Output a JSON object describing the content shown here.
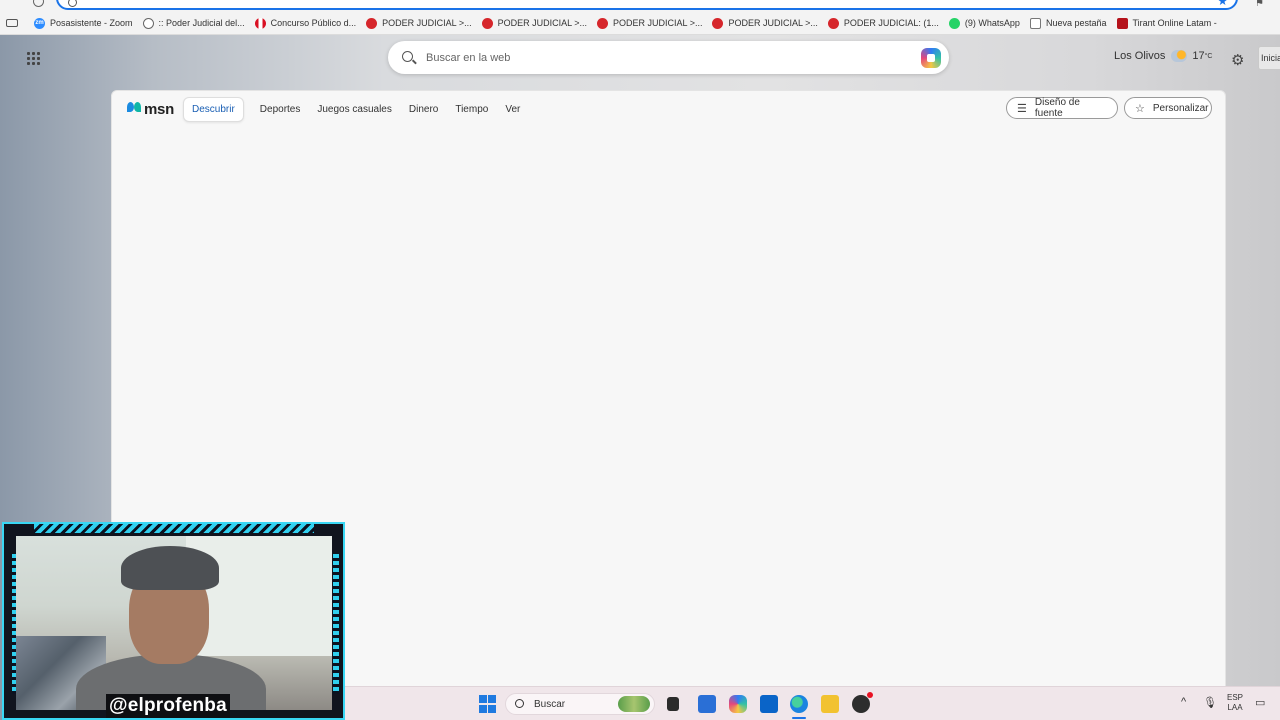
{
  "bookmarks": [
    {
      "label": "Posasistente - Zoom",
      "icon": "zoom-icon",
      "color": "#2d8cff"
    },
    {
      "label": ":: Poder Judicial del...",
      "icon": "globe-icon",
      "color": "#666666"
    },
    {
      "label": "Concurso Público d...",
      "icon": "peru-flag-icon",
      "color": "#d91023"
    },
    {
      "label": "PODER JUDICIAL >...",
      "icon": "pj-icon",
      "color": "#d6262b"
    },
    {
      "label": "PODER JUDICIAL >...",
      "icon": "pj-icon",
      "color": "#d6262b"
    },
    {
      "label": "PODER JUDICIAL >...",
      "icon": "pj-icon",
      "color": "#d6262b"
    },
    {
      "label": "PODER JUDICIAL >...",
      "icon": "pj-icon",
      "color": "#d6262b"
    },
    {
      "label": "PODER JUDICIAL: (1...",
      "icon": "pj-icon",
      "color": "#d6262b"
    },
    {
      "label": "(9) WhatsApp",
      "icon": "whatsapp-icon",
      "color": "#25d366"
    },
    {
      "label": "Nueva pestaña",
      "icon": "new-tab-icon",
      "color": "#777777"
    },
    {
      "label": "Tirant Online Latam -",
      "icon": "tirant-icon",
      "color": "#b5121b"
    }
  ],
  "search": {
    "placeholder": "Buscar en la web"
  },
  "weather": {
    "location": "Los Olivos",
    "temperature": "17",
    "unit": "°C"
  },
  "signin": {
    "label": "Inicia"
  },
  "msn": {
    "logo_text": "msn",
    "tabs": [
      {
        "label": "Descubrir",
        "active": true
      },
      {
        "label": "Deportes"
      },
      {
        "label": "Juegos casuales"
      },
      {
        "label": "Dinero"
      },
      {
        "label": "Tiempo"
      },
      {
        "label": "Ver"
      }
    ],
    "feed_design_label": "Diseño de fuente",
    "personalize_label": "Personalizar"
  },
  "overlay": {
    "handle": "@elprofenba"
  },
  "taskbar": {
    "search_label": "Buscar",
    "language_top": "ESP",
    "language_bottom": "LAA"
  },
  "colors": {
    "accent": "#1a73e8",
    "frame": "#39d7f4"
  }
}
